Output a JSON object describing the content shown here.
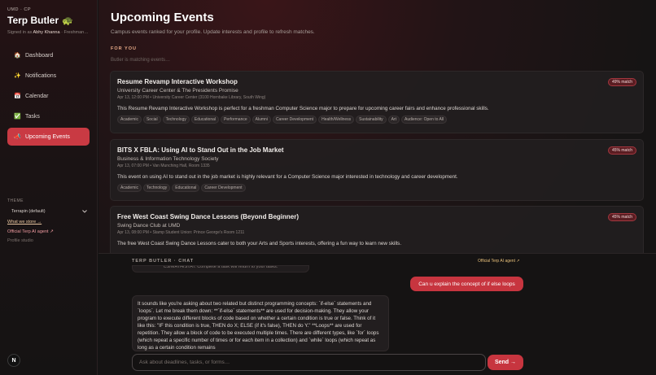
{
  "sidebar": {
    "kicker": "UMD · CP",
    "title": "Terp Butler",
    "signed_in_prefix": "Signed in as",
    "user_name": "Abhy Khanna",
    "user_detail": "· Freshman…",
    "nav": [
      {
        "label": "Dashboard",
        "icon": "house-icon",
        "glyph": "🏠",
        "active": false
      },
      {
        "label": "Notifications",
        "icon": "sparkle-icon",
        "glyph": "✨",
        "active": false
      },
      {
        "label": "Calendar",
        "icon": "calendar-icon",
        "glyph": "📅",
        "active": false
      },
      {
        "label": "Tasks",
        "icon": "checkbox-icon",
        "glyph": "✅",
        "active": false
      },
      {
        "label": "Upcoming Events",
        "icon": "megaphone-icon",
        "glyph": "📣",
        "active": true
      }
    ],
    "theme_label": "THEME",
    "theme_value": "Terrapin (default)",
    "store_link": "What we store →",
    "agent_link": "Official Terp AI agent ↗",
    "profile_link": "Profile studio",
    "avatar_letter": "N"
  },
  "main": {
    "title": "Upcoming Events",
    "subtitle": "Campus events ranked for your profile. Update interests and profile to refresh matches.",
    "section_label": "FOR YOU",
    "matching_text": "Butler is matching events…",
    "events": [
      {
        "title": "Resume Revamp Interactive Workshop",
        "host": "University Career Center & The Presidents Promise",
        "meta": "Apr 13, 12:00 PM • University Career Center (3100 Hornbake Library, South Wing)",
        "match": "49% match",
        "description": "This Resume Revamp Interactive Workshop is perfect for a freshman Computer Science major to prepare for upcoming career fairs and enhance professional skills.",
        "tags": [
          "Academic",
          "Social",
          "Technology",
          "Educational",
          "Performance",
          "Alumni",
          "Career Development",
          "Health/Wellness",
          "Sustainability",
          "Art",
          "Audience: Open to All"
        ]
      },
      {
        "title": "BITS X FBLA: Using AI to Stand Out in the Job Market",
        "host": "Business & Information Technology Society",
        "meta": "Apr 13, 07:00 PM • Van Munching Hall, Room 1335",
        "match": "45% match",
        "description": "This event on using AI to stand out in the job market is highly relevant for a Computer Science major interested in technology and career development.",
        "tags": [
          "Academic",
          "Technology",
          "Educational",
          "Career Development"
        ]
      },
      {
        "title": "Free West Coast Swing Dance Lessons (Beyond Beginner)",
        "host": "Swing Dance Club at UMD",
        "meta": "Apr 13, 08:00 PM • Stamp Student Union: Prince George's Room 1211",
        "match": "45% match",
        "description": "The free West Coast Swing Dance Lessons cater to both your Arts and Sports interests, offering a fun way to learn new skills.",
        "tags": []
      }
    ]
  },
  "chat": {
    "label": "TERP BUTLER · CHAT",
    "agent_link": "Official Terp AI agent ↗",
    "prev_message": "CS/MATH/STAT. Complete a task will return to your tasks.",
    "user_message": "Can u explain the concept of if else loops",
    "bot_message": "It sounds like you're asking about two related but distinct programming concepts: `if-else` statements and `loops`. Let me break them down: **`if-else` statements** are used for decision-making. They allow your program to execute different blocks of code based on whether a certain condition is true or false. Think of it like this: \"IF this condition is true, THEN do X; ELSE (if it's false), THEN do Y.\" **Loops** are used for repetition. They allow a block of code to be executed multiple times. There are different types, like `for` loops (which repeat a specific number of times or for each item in a collection) and `while` loops (which repeat as long as a certain condition remains",
    "input_placeholder": "Ask about deadlines, tasks, or forms…",
    "input_value": "",
    "send_label": "Send →"
  },
  "colors": {
    "accent": "#c7353f",
    "match_badge_bg": "#5a1d22",
    "section_label": "#e7a987",
    "link": "#e8c07a"
  }
}
